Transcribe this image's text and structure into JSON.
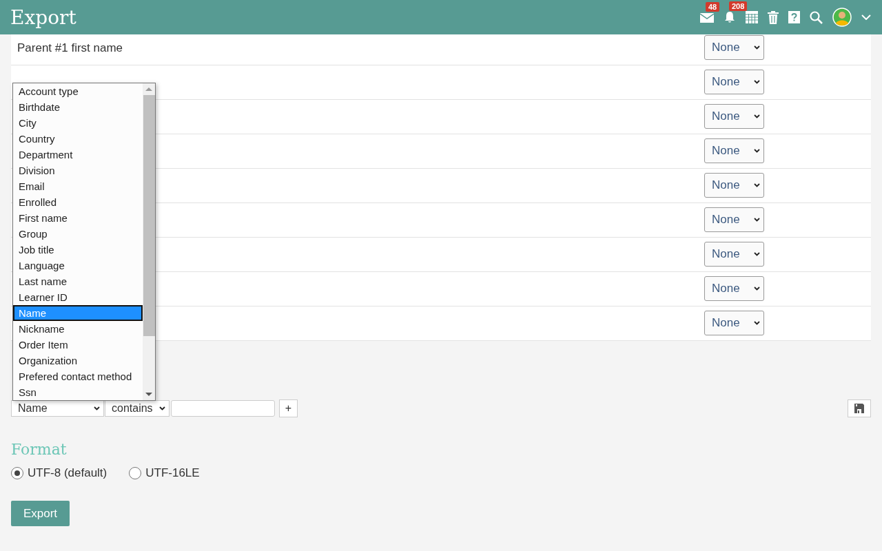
{
  "header": {
    "title": "Export",
    "icons": [
      {
        "kind": "mail",
        "badge": "48"
      },
      {
        "kind": "bell",
        "badge": "208"
      },
      {
        "kind": "calendar"
      },
      {
        "kind": "trash"
      },
      {
        "kind": "help"
      },
      {
        "kind": "search"
      },
      {
        "kind": "avatar"
      },
      {
        "kind": "caret"
      }
    ]
  },
  "fields": [
    {
      "label": "Parent #1 first name",
      "mapping": "None"
    },
    {
      "mapping": "None"
    },
    {
      "mapping": "None"
    },
    {
      "mapping": "None"
    },
    {
      "mapping": "None"
    },
    {
      "mapping": "None"
    },
    {
      "mapping": "None"
    },
    {
      "mapping": "None"
    },
    {
      "mapping": "None"
    }
  ],
  "filter": {
    "field": "Name",
    "operator": "contains",
    "add_button": "+",
    "options": [
      {
        "label": "Account type",
        "selected": false
      },
      {
        "label": "Birthdate",
        "selected": false
      },
      {
        "label": "City",
        "selected": false
      },
      {
        "label": "Country",
        "selected": false
      },
      {
        "label": "Department",
        "selected": false
      },
      {
        "label": "Division",
        "selected": false
      },
      {
        "label": "Email",
        "selected": false
      },
      {
        "label": "Enrolled",
        "selected": false
      },
      {
        "label": "First name",
        "selected": false
      },
      {
        "label": "Group",
        "selected": false
      },
      {
        "label": "Job title",
        "selected": false
      },
      {
        "label": "Language",
        "selected": false
      },
      {
        "label": "Last name",
        "selected": false
      },
      {
        "label": "Learner ID",
        "selected": false
      },
      {
        "label": "Name",
        "selected": true
      },
      {
        "label": "Nickname",
        "selected": false
      },
      {
        "label": "Order Item",
        "selected": false
      },
      {
        "label": "Organization",
        "selected": false
      },
      {
        "label": "Prefered contact method",
        "selected": false
      },
      {
        "label": "Ssn",
        "selected": false
      }
    ]
  },
  "format": {
    "heading": "Format",
    "options": [
      {
        "label": "UTF-8 (default)",
        "selected": true
      },
      {
        "label": "UTF-16LE",
        "selected": false
      }
    ]
  },
  "export_button": "Export"
}
